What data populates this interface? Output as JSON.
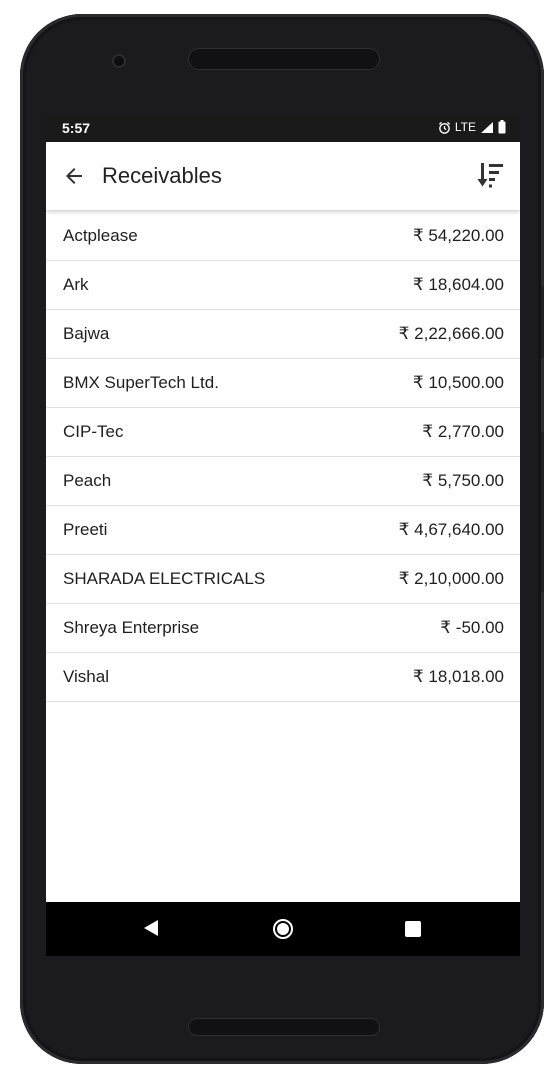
{
  "status_bar": {
    "time": "5:57",
    "network": "LTE",
    "icons": [
      "alarm-icon",
      "signal-icon",
      "battery-icon"
    ]
  },
  "app_bar": {
    "title": "Receivables",
    "back_icon": "arrow-left-icon",
    "sort_icon": "sort-descending-icon"
  },
  "receivables": [
    {
      "name": "Actplease",
      "amount": "₹ 54,220.00"
    },
    {
      "name": "Ark",
      "amount": "₹ 18,604.00"
    },
    {
      "name": "Bajwa",
      "amount": "₹ 2,22,666.00"
    },
    {
      "name": "BMX SuperTech Ltd.",
      "amount": "₹ 10,500.00"
    },
    {
      "name": "CIP-Tec",
      "amount": "₹ 2,770.00"
    },
    {
      "name": "Peach",
      "amount": "₹ 5,750.00"
    },
    {
      "name": "Preeti",
      "amount": "₹ 4,67,640.00"
    },
    {
      "name": "SHARADA ELECTRICALS",
      "amount": "₹ 2,10,000.00"
    },
    {
      "name": "Shreya Enterprise",
      "amount": "₹ -50.00"
    },
    {
      "name": "Vishal",
      "amount": "₹ 18,018.00"
    }
  ],
  "nav_bar": {
    "icons": [
      "nav-back-icon",
      "nav-home-icon",
      "nav-recents-icon"
    ]
  }
}
